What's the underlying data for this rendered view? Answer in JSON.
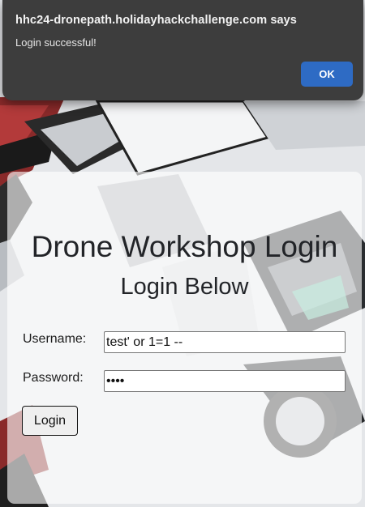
{
  "alert": {
    "title": "hhc24-dronepath.holidayhackchallenge.com says",
    "message": "Login successful!",
    "ok_label": "OK",
    "button_color": "#2e6bc4"
  },
  "login": {
    "title": "Drone Workshop Login",
    "subtitle": "Login Below",
    "username_label": "Username:",
    "username_value": "test' or 1=1 --",
    "password_label": "Password:",
    "password_value": "test",
    "button_label": "Login"
  }
}
